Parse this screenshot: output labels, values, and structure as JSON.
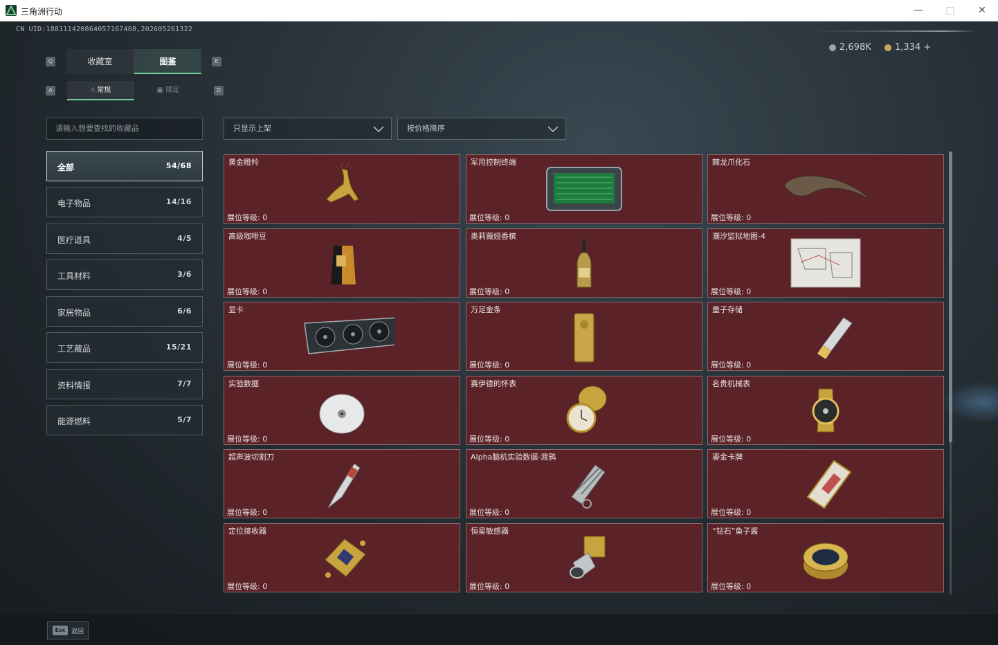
{
  "window": {
    "title": "三角洲行动"
  },
  "uid": "CN UID:1881114208640571674​68,202605261322",
  "currency": {
    "coupons": "2,698K",
    "coins": "1,334 +"
  },
  "keyhints": {
    "prev_tab": "Q",
    "next_tab": "E",
    "prev_sub": "A",
    "next_sub": "D"
  },
  "tabs": {
    "collection": "收藏室",
    "catalog": "图鉴"
  },
  "subtabs": {
    "normal": "常规",
    "limited": "限定"
  },
  "search": {
    "placeholder": "请输入想要查找的收藏品"
  },
  "filters": {
    "shelf": "只显示上架",
    "sort": "按价格降序"
  },
  "categories": [
    {
      "name": "全部",
      "count": "54/68"
    },
    {
      "name": "电子物品",
      "count": "14/16"
    },
    {
      "name": "医疗道具",
      "count": "4/5"
    },
    {
      "name": "工具材料",
      "count": "3/6"
    },
    {
      "name": "家居物品",
      "count": "6/6"
    },
    {
      "name": "工艺藏品",
      "count": "15/21"
    },
    {
      "name": "资料情报",
      "count": "7/7"
    },
    {
      "name": "能源燃料",
      "count": "5/7"
    }
  ],
  "level_label": "展位等级: 0",
  "items": [
    {
      "name": "黄金瞪羚",
      "icon": "gold-gazelle-icon"
    },
    {
      "name": "军用控制终端",
      "icon": "control-terminal-icon"
    },
    {
      "name": "棘龙爪化石",
      "icon": "claw-fossil-icon"
    },
    {
      "name": "高级咖啡豆",
      "icon": "coffee-bag-icon"
    },
    {
      "name": "奥莉薇娅香槟",
      "icon": "champagne-icon"
    },
    {
      "name": "潮汐监狱地图-4",
      "icon": "map-icon"
    },
    {
      "name": "显卡",
      "icon": "graphics-card-icon"
    },
    {
      "name": "万足金条",
      "icon": "gold-bar-icon"
    },
    {
      "name": "量子存储",
      "icon": "usb-drive-icon"
    },
    {
      "name": "实验数据",
      "icon": "disc-icon"
    },
    {
      "name": "赛伊德的怀表",
      "icon": "pocket-watch-icon"
    },
    {
      "name": "名贵机械表",
      "icon": "wristwatch-icon"
    },
    {
      "name": "超声波切割刀",
      "icon": "ultrasonic-knife-icon"
    },
    {
      "name": "Alpha脑机实验数据-渡鸦",
      "icon": "data-canister-icon"
    },
    {
      "name": "鎏金卡牌",
      "icon": "gilded-card-icon"
    },
    {
      "name": "定位接收器",
      "icon": "receiver-icon"
    },
    {
      "name": "恒星敏感器",
      "icon": "star-sensor-icon"
    },
    {
      "name": "“钻石”鱼子酱",
      "icon": "caviar-tin-icon"
    }
  ],
  "footer": {
    "esc_key": "Esc",
    "back_label": "返回"
  },
  "colors": {
    "card_bg": "#5b2328",
    "accent": "#6fcf97"
  }
}
